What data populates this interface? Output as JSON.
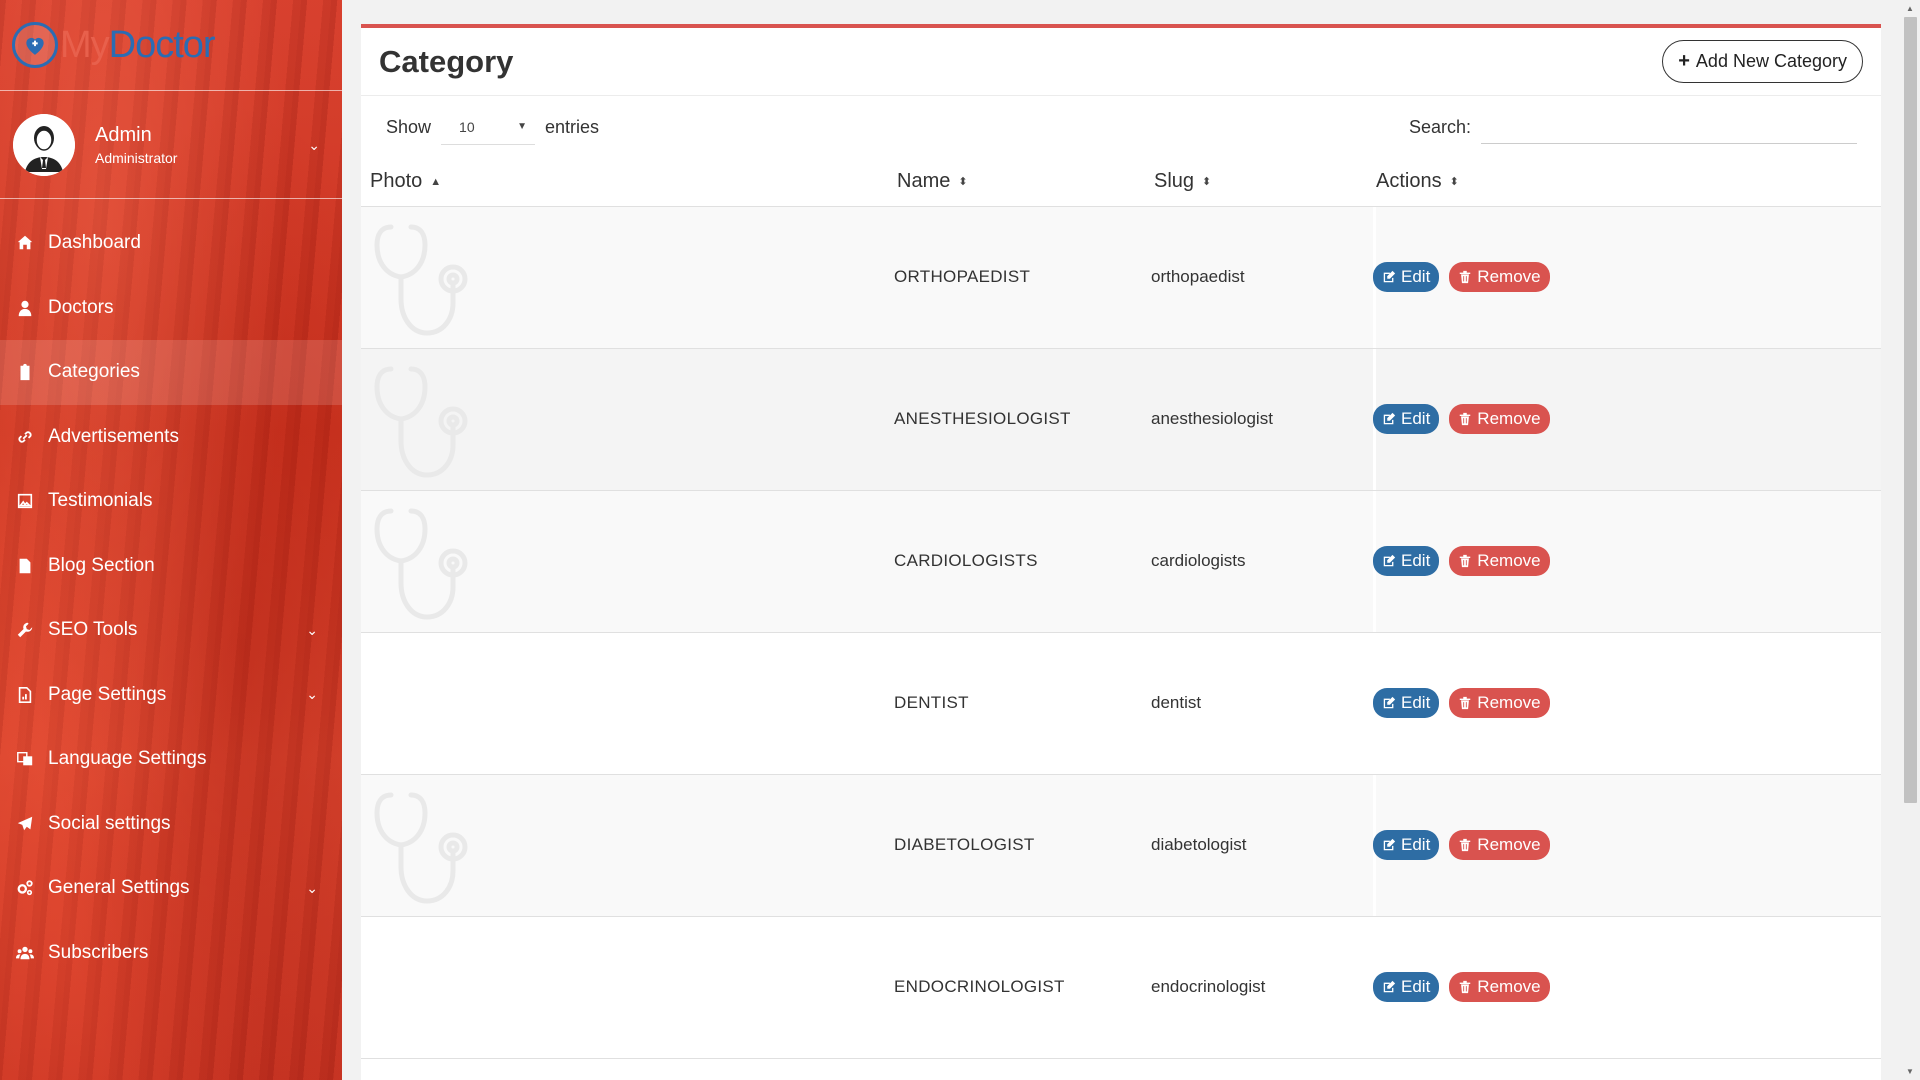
{
  "brand": {
    "part1": "My",
    "part2": "Doctor"
  },
  "user": {
    "name": "Admin",
    "role": "Administrator"
  },
  "nav": [
    {
      "label": "Dashboard",
      "icon": "home-icon",
      "has_caret": false
    },
    {
      "label": "Doctors",
      "icon": "user-md-icon",
      "has_caret": false
    },
    {
      "label": "Categories",
      "icon": "clipboard-icon",
      "has_caret": false,
      "active": true
    },
    {
      "label": "Advertisements",
      "icon": "link-icon",
      "has_caret": false
    },
    {
      "label": "Testimonials",
      "icon": "image-icon",
      "has_caret": false
    },
    {
      "label": "Blog Section",
      "icon": "file-icon",
      "has_caret": false
    },
    {
      "label": "SEO Tools",
      "icon": "wrench-icon",
      "has_caret": true
    },
    {
      "label": "Page Settings",
      "icon": "file-chart-icon",
      "has_caret": true
    },
    {
      "label": "Language Settings",
      "icon": "translate-icon",
      "has_caret": false
    },
    {
      "label": "Social settings",
      "icon": "paper-plane-icon",
      "has_caret": false
    },
    {
      "label": "General Settings",
      "icon": "cogs-icon",
      "has_caret": true
    },
    {
      "label": "Subscribers",
      "icon": "users-icon",
      "has_caret": false
    }
  ],
  "page": {
    "title": "Category",
    "add_button": "Add New Category"
  },
  "table_controls": {
    "show_label": "Show",
    "page_length": "10",
    "entries_label": "entries",
    "search_label": "Search:",
    "search_value": ""
  },
  "columns": {
    "photo": "Photo",
    "name": "Name",
    "slug": "Slug",
    "actions": "Actions"
  },
  "row_buttons": {
    "edit": "Edit",
    "remove": "Remove"
  },
  "rows": [
    {
      "name": "ORTHOPAEDIST",
      "slug": "orthopaedist",
      "has_photo": true
    },
    {
      "name": "ANESTHESIOLOGIST",
      "slug": "anesthesiologist",
      "has_photo": true
    },
    {
      "name": "CARDIOLOGISTS",
      "slug": "cardiologists",
      "has_photo": true
    },
    {
      "name": "DENTIST",
      "slug": "dentist",
      "has_photo": false
    },
    {
      "name": "DIABETOLOGIST",
      "slug": "diabetologist",
      "has_photo": true
    },
    {
      "name": "ENDOCRINOLOGIST",
      "slug": "endocrinologist",
      "has_photo": false
    }
  ],
  "colors": {
    "accent_red": "#d9534f",
    "edit_blue": "#2e6da4",
    "sidebar_red": "#c9331f"
  }
}
